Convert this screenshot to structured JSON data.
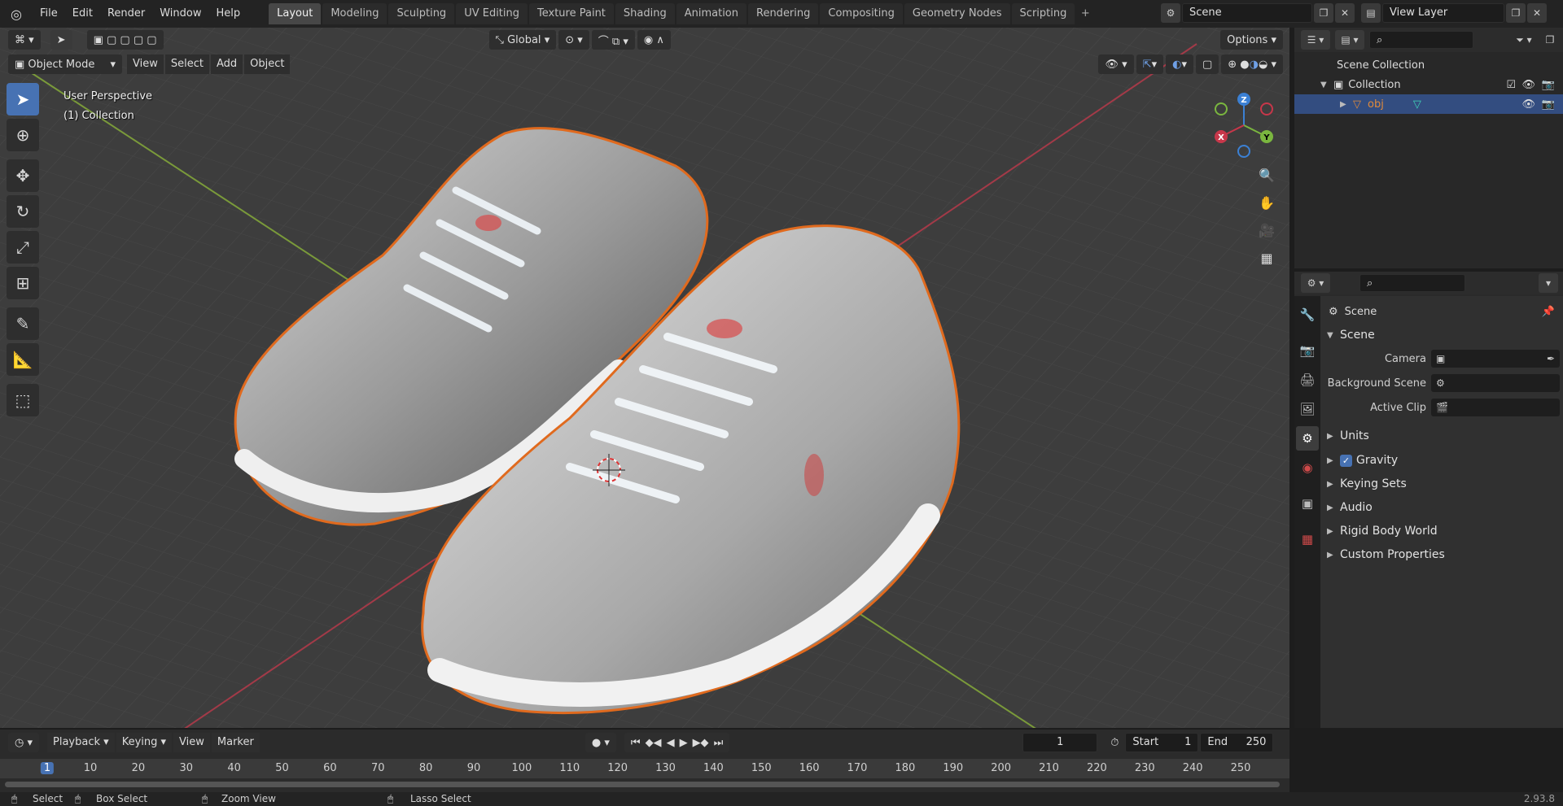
{
  "menu": {
    "file": "File",
    "edit": "Edit",
    "render": "Render",
    "window": "Window",
    "help": "Help"
  },
  "workspaces": [
    "Layout",
    "Modeling",
    "Sculpting",
    "UV Editing",
    "Texture Paint",
    "Shading",
    "Animation",
    "Rendering",
    "Compositing",
    "Geometry Nodes",
    "Scripting"
  ],
  "top_right": {
    "scene": "Scene",
    "view_layer": "View Layer"
  },
  "viewport": {
    "transform_orientation": "Global",
    "options": "Options",
    "mode": "Object Mode",
    "menus": {
      "view": "View",
      "select": "Select",
      "add": "Add",
      "object": "Object"
    },
    "info_line1": "User Perspective",
    "info_line2": "(1) Collection",
    "gizmo": {
      "x": "X",
      "y": "Y",
      "z": "Z"
    }
  },
  "outliner": {
    "scene_collection": "Scene Collection",
    "collection": "Collection",
    "object": "obj"
  },
  "properties": {
    "header": "Scene",
    "panel_scene": "Scene",
    "camera_label": "Camera",
    "background_label": "Background Scene",
    "clip_label": "Active Clip",
    "units": "Units",
    "gravity": "Gravity",
    "keying_sets": "Keying Sets",
    "audio": "Audio",
    "rigid_body": "Rigid Body World",
    "custom_props": "Custom Properties"
  },
  "timeline": {
    "playback": "Playback",
    "keying": "Keying",
    "view": "View",
    "marker": "Marker",
    "current_frame": "1",
    "start_label": "Start",
    "start": "1",
    "end_label": "End",
    "end": "250",
    "ticks": [
      "1",
      "10",
      "20",
      "30",
      "40",
      "50",
      "60",
      "70",
      "80",
      "90",
      "100",
      "110",
      "120",
      "130",
      "140",
      "150",
      "160",
      "170",
      "180",
      "190",
      "200",
      "210",
      "220",
      "230",
      "240",
      "250"
    ]
  },
  "status": {
    "select": "Select",
    "box_select": "Box Select",
    "zoom_view": "Zoom View",
    "lasso_select": "Lasso Select",
    "version": "2.93.8"
  },
  "colors": {
    "accent": "#4772b3",
    "selection_outline": "#e06a1e",
    "x_axis": "#c7374a",
    "y_axis": "#7ab63f",
    "z_axis": "#3b80d4"
  }
}
